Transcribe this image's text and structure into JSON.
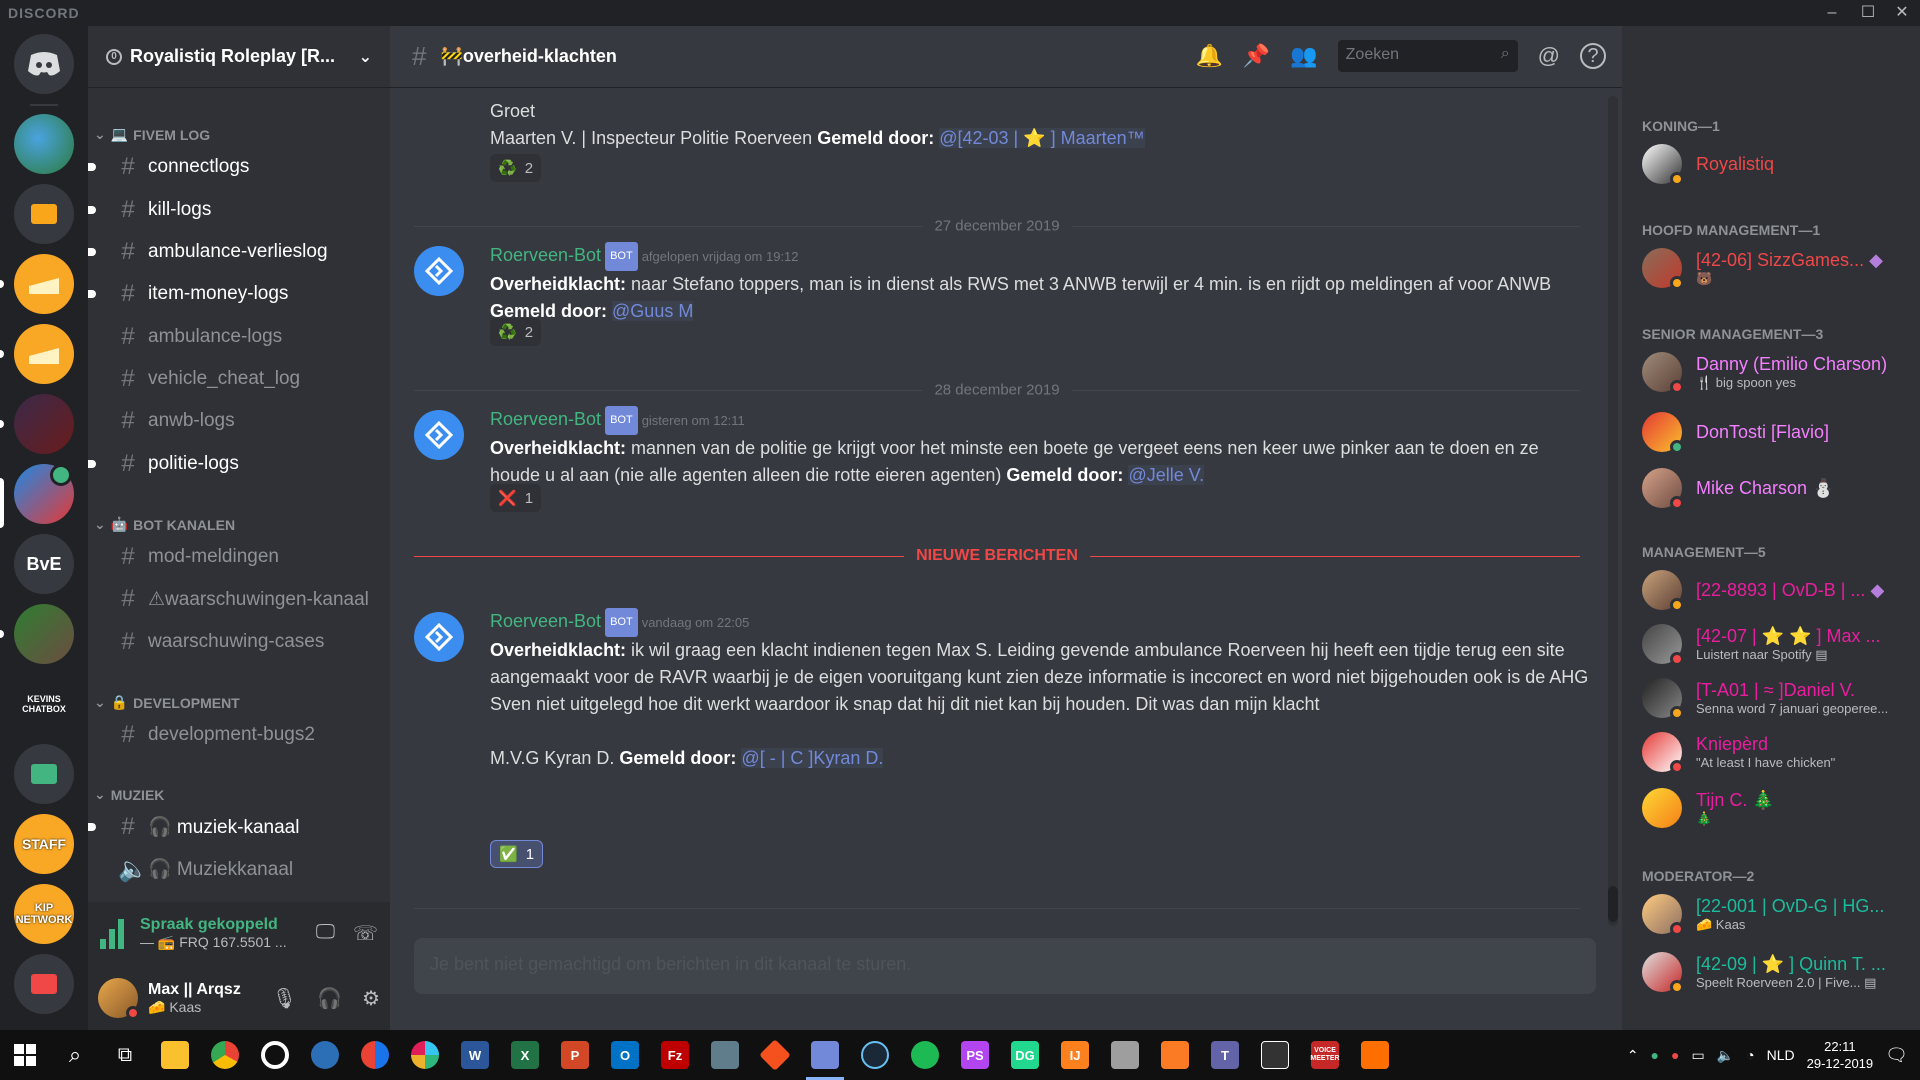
{
  "app": {
    "name": "DISCORD"
  },
  "server": {
    "name": "Royalistiq Roleplay [R...",
    "bubble": "0"
  },
  "guild_labels": {
    "bve": "BvE",
    "kevins": "KEVINS CHATBOX",
    "staff": "STAFF",
    "kip": "KIP NETWORK"
  },
  "categories": {
    "fivem": "FIVEM LOG",
    "bot": "BOT KANALEN",
    "dev": "DEVELOPMENT",
    "muziek": "MUZIEK"
  },
  "channels": [
    {
      "name": "connectlogs",
      "unread": true
    },
    {
      "name": "kill-logs",
      "unread": true
    },
    {
      "name": "ambulance-verlieslog",
      "unread": true
    },
    {
      "name": "item-money-logs",
      "unread": true
    },
    {
      "name": "ambulance-logs",
      "unread": false
    },
    {
      "name": "vehicle_cheat_log",
      "unread": false
    },
    {
      "name": "anwb-logs",
      "unread": false
    },
    {
      "name": "politie-logs",
      "unread": true
    },
    {
      "name": "mod-meldingen",
      "unread": false
    },
    {
      "name": "⚠waarschuwingen-kanaal",
      "unread": false
    },
    {
      "name": "waarschuwing-cases",
      "unread": false
    },
    {
      "name": "development-bugs2",
      "unread": false
    },
    {
      "name": "🎧 muziek-kanaal",
      "unread": true
    },
    {
      "name": "🎧 Muziekkanaal",
      "unread": false
    }
  ],
  "voice": {
    "status": "Spraak gekoppeld",
    "channel": "— 📻 FRQ 167.5501 ..."
  },
  "user": {
    "name": "Max || Arqsz",
    "status": "🧀 Kaas"
  },
  "channel_header": {
    "title": "🚧overheid-klachten",
    "search_placeholder": "Zoeken"
  },
  "messages": {
    "partial": {
      "line1": "Groet",
      "line2": "Maarten V. | Inspecteur Politie Roerveen",
      "gemeld": "Gemeld door:",
      "mention": "@[42-03 | ⭐ ] Maarten™",
      "react_emoji": "♻️",
      "react_count": "2"
    },
    "div1": "27 december 2019",
    "m1": {
      "author": "Roerveen-Bot",
      "tag": "BOT",
      "ts": "afgelopen vrijdag om 19:12",
      "label": "Overheidklacht:",
      "text": " naar Stefano toppers, man is in dienst als RWS met 3 ANWB terwijl er 4 min. is en rijdt op meldingen af voor ANWB ",
      "gemeld": "Gemeld door:",
      "mention": "@Guus M",
      "react_emoji": "♻️",
      "react_count": "2"
    },
    "div2": "28 december 2019",
    "m2": {
      "author": "Roerveen-Bot",
      "tag": "BOT",
      "ts": "gisteren om 12:11",
      "label": "Overheidklacht:",
      "text": " mannen van de politie ge krijgt voor het minste een boete ge vergeet eens nen keer uwe pinker aan te doen en ze houde u al aan (nie alle agenten alleen die rotte eieren agenten) ",
      "gemeld": "Gemeld door:",
      "mention": "@Jelle V.",
      "react_emoji": "❌",
      "react_count": "1"
    },
    "new_label": "NIEUWE BERICHTEN",
    "m3": {
      "author": "Roerveen-Bot",
      "tag": "BOT",
      "ts": "vandaag om 22:05",
      "label": "Overheidklacht:",
      "text": " ik wil graag een klacht indienen tegen Max S. Leiding gevende ambulance Roerveen hij heeft een tijdje terug een site aangemaakt voor de RAVR waarbij je   de eigen vooruitgang kunt zien deze informatie is inccorect en word niet bijgehouden ook is de AHG Sven niet uitgelegd hoe dit werkt waardoor ik snap dat hij dit niet kan bij houden. Dit was dan mijn klacht",
      "signoff": "M.V.G Kyran D.",
      "gemeld": "Gemeld door:",
      "mention": "@[ - | C ]Kyran D.",
      "react_emoji": "✅",
      "react_count": "1"
    }
  },
  "composer": {
    "placeholder": "Je bent niet gemachtigd om berichten in dit kanaal te sturen."
  },
  "member_groups": {
    "koning": "KONING—1",
    "hoofd": "HOOFD MANAGEMENT—1",
    "senior": "SENIOR MANAGEMENT—3",
    "management": "MANAGEMENT—5",
    "moderator": "MODERATOR—2"
  },
  "members": [
    {
      "name": "Royalistiq",
      "status": "",
      "color": "#f04747"
    },
    {
      "name": "[42-06] SizzGames...",
      "status": "🐻",
      "color": "#f04747"
    },
    {
      "name": "Danny (Emilio Charson)",
      "status": "🍴 big spoon yes",
      "color": "#f47fff"
    },
    {
      "name": "DonTosti [Flavio]",
      "status": "",
      "color": "#f47fff"
    },
    {
      "name": "Mike Charson ⛄",
      "status": "",
      "color": "#f47fff"
    },
    {
      "name": "[22-8893 | OvD-B | ...",
      "status": "",
      "color": "#e91e9f"
    },
    {
      "name": "[42-07 | ⭐ ⭐ ] Max ...",
      "status": "Luistert naar Spotify",
      "color": "#e91e9f"
    },
    {
      "name": "[T-A01 | ≈ ]Daniel V.",
      "status": "Senna word 7 januari geoperee...",
      "color": "#e91e9f"
    },
    {
      "name": "Kniepèrd",
      "status": "\"At least I have chicken\"",
      "color": "#e91e9f"
    },
    {
      "name": "Tijn C. 🎄",
      "status": "🎄",
      "color": "#e91e9f"
    },
    {
      "name": "[22-001 | OvD-G | HG...",
      "status": "🧀 Kaas",
      "color": "#1abc9c"
    },
    {
      "name": "[42-09 | ⭐ ] Quinn T. ...",
      "status": "Speelt Roerveen 2.0 | Five...",
      "color": "#1abc9c"
    }
  ],
  "taskbar": {
    "lang": "NLD",
    "time": "22:11",
    "date": "29-12-2019",
    "voicemeeter": "VOICE MEETER"
  },
  "colors": {
    "accent": "#7289da",
    "online": "#43b581",
    "dnd": "#f04747",
    "idle": "#faa61a",
    "new_messages": "#f04747"
  }
}
